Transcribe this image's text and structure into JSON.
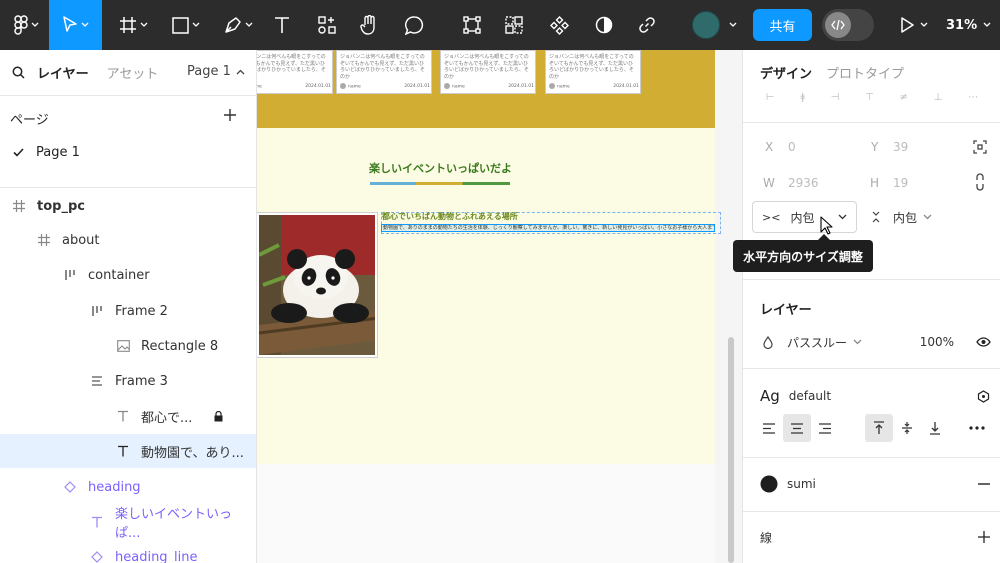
{
  "toolbar": {
    "share_label": "共有",
    "zoom": "31%"
  },
  "left_panel": {
    "tab_layers": "レイヤー",
    "tab_assets": "アセット",
    "page_switch": "Page 1",
    "pages_heading": "ページ",
    "pages": [
      {
        "name": "Page 1"
      }
    ],
    "layers": [
      {
        "name": "top_pc"
      },
      {
        "name": "about"
      },
      {
        "name": "container"
      },
      {
        "name": "Frame 2"
      },
      {
        "name": "Rectangle 8"
      },
      {
        "name": "Frame 3"
      },
      {
        "name": "都心で..."
      },
      {
        "name": "動物園で、あり..."
      },
      {
        "name": "heading"
      },
      {
        "name": "楽しいイベントいっぱ..."
      },
      {
        "name": "heading_line"
      }
    ]
  },
  "canvas": {
    "card_text": "ジョバンニは何べんも眼をこすってのぞいてもかんでも見えず、ただ黒いひろいどばかりひかっていましたら、そのか",
    "card_author": "name",
    "card_date": "2024.01.01",
    "heading": "楽しいイベントいっぱいだよ",
    "sub_heading": "都心でいちばん動物とふれあえる場所",
    "body_text": "動物園で、ありのままの動物たちの生活を体験、じっくり観察してみませんか。楽しい、驚きに、新しい発見がいっぱい。小さなお子様から大人まで楽しめる"
  },
  "right_panel": {
    "tab_design": "デザイン",
    "tab_prototype": "プロトタイプ",
    "x_label": "X",
    "x_value": "0",
    "y_label": "Y",
    "y_value": "39",
    "w_label": "W",
    "w_value": "2936",
    "h_label": "H",
    "h_value": "19",
    "h_resize_value": "内包",
    "v_resize_value": "内包",
    "tooltip": "水平方向のサイズ調整",
    "layer_heading": "レイヤー",
    "blend_mode": "パススルー",
    "opacity": "100%",
    "text_style_icon": "Ag",
    "text_style_name": "default",
    "fill_name": "sumi",
    "fill_color": "#1e1e1e",
    "stroke_heading": "線"
  },
  "colors": {
    "accent": "#0d99ff",
    "toolbar_bg": "#2c2c2c",
    "component_purple": "#7b61ff",
    "canvas_yellow": "#d1ad34",
    "canvas_cream": "#fcfbe4",
    "heading_green": "#3b7a1e"
  }
}
